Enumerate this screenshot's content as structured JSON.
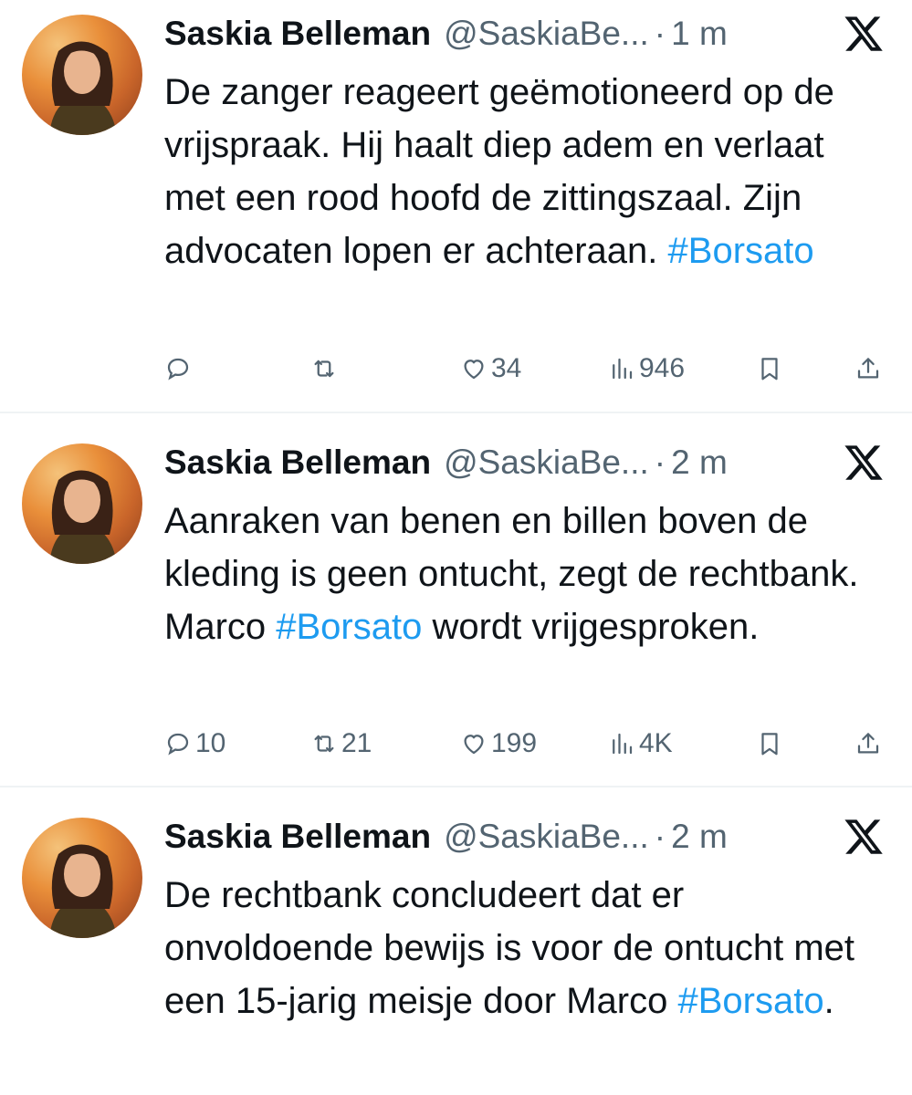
{
  "tweets": [
    {
      "author_name": "Saskia Belleman",
      "author_handle": "@SaskiaBe...",
      "time": "1 m",
      "text_parts": [
        "De zanger reageert geëmotioneerd op de vrijspraak. Hij haalt diep adem en verlaat met een rood hoofd de zittingszaal. Zijn advocaten lopen er achteraan. ",
        "#Borsato",
        ""
      ],
      "actions": {
        "replies": "",
        "reposts": "",
        "likes": "34",
        "views": "946"
      }
    },
    {
      "author_name": "Saskia Belleman",
      "author_handle": "@SaskiaBe...",
      "time": "2 m",
      "text_parts": [
        "Aanraken van benen en billen boven de kleding is geen ontucht, zegt de rechtbank. Marco ",
        "#Borsato",
        " wordt vrijgesproken."
      ],
      "actions": {
        "replies": "10",
        "reposts": "21",
        "likes": "199",
        "views": "4K"
      }
    },
    {
      "author_name": "Saskia Belleman",
      "author_handle": "@SaskiaBe...",
      "time": "2 m",
      "text_parts": [
        "De rechtbank concludeert dat er onvoldoende bewijs is voor de ontucht met een 15-jarig meisje door Marco ",
        "#Borsato",
        "."
      ]
    }
  ],
  "separator": "·",
  "icons": {
    "reply": "reply-icon",
    "repost": "repost-icon",
    "like": "heart-icon",
    "views": "views-icon",
    "bookmark": "bookmark-icon",
    "share": "share-icon",
    "platform": "x-logo-icon"
  },
  "colors": {
    "hashtag": "#1d9bf0",
    "secondary_text": "#536471",
    "primary_text": "#0f1419"
  }
}
